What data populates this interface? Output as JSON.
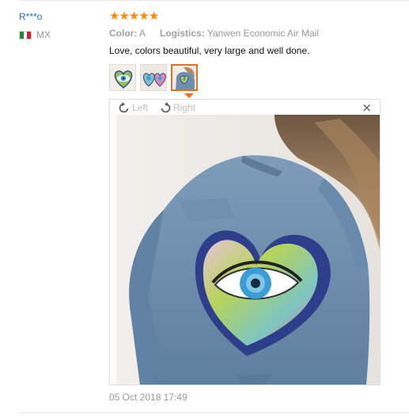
{
  "reviewer": {
    "name": "R***o",
    "country_code": "MX",
    "flag_icon": "mexico-flag-icon"
  },
  "rating": {
    "stars": 5,
    "max": 5,
    "color": "#ff8a00"
  },
  "meta": {
    "color_label": "Color:",
    "color_value": "A",
    "logistics_label": "Logistics:",
    "logistics_value": "Yanwen Economic Air Mail"
  },
  "review": {
    "text": "Love, colors beautiful, very large and well done.",
    "date": "05 Oct 2018 17:49"
  },
  "viewer": {
    "rotate_left_label": "Left",
    "rotate_right_label": "Right",
    "close_label": "×"
  },
  "thumbnails": [
    {
      "name": "heart-eye-patch-thumb",
      "active": false
    },
    {
      "name": "heart-eye-patch-pair-thumb",
      "active": false
    },
    {
      "name": "denim-jacket-thumb",
      "active": true
    }
  ],
  "colors": {
    "accent": "#e86d1c",
    "link": "#2670c4",
    "muted": "#999999"
  }
}
